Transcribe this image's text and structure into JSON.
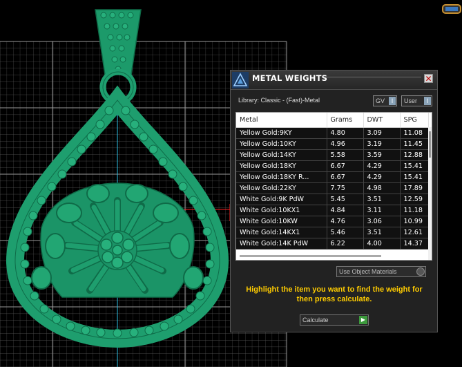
{
  "panel": {
    "title": "METAL WEIGHTS",
    "close_glyph": "✕",
    "library_label": "Library: Classic - (Fast)-Metal",
    "toggles": [
      {
        "label": "GV",
        "button_glyph": "I"
      },
      {
        "label": "User",
        "button_glyph": "I"
      }
    ],
    "table": {
      "columns": [
        "Metal",
        "Grams",
        "DWT",
        "SPG"
      ],
      "rows": [
        [
          "Yellow Gold:9KY",
          "4.80",
          "3.09",
          "11.08"
        ],
        [
          "Yellow Gold:10KY",
          "4.96",
          "3.19",
          "11.45"
        ],
        [
          "Yellow Gold:14KY",
          "5.58",
          "3.59",
          "12.88"
        ],
        [
          "Yellow Gold:18KY",
          "6.67",
          "4.29",
          "15.41"
        ],
        [
          "Yellow Gold:18KY R...",
          "6.67",
          "4.29",
          "15.41"
        ],
        [
          "Yellow Gold:22KY",
          "7.75",
          "4.98",
          "17.89"
        ],
        [
          "White Gold:9K PdW",
          "5.45",
          "3.51",
          "12.59"
        ],
        [
          "White Gold:10KX1",
          "4.84",
          "3.11",
          "11.18"
        ],
        [
          "White Gold:10KW",
          "4.76",
          "3.06",
          "10.99"
        ],
        [
          "White Gold:14KX1",
          "5.46",
          "3.51",
          "12.61"
        ],
        [
          "White Gold:14K PdW",
          "6.22",
          "4.00",
          "14.37"
        ]
      ]
    },
    "use_object_materials": "Use Object Materials",
    "instructions": "Highlight the item you want to find the weight for then press calculate.",
    "calculate_label": "Calculate",
    "calculate_arrow": "▶"
  },
  "colors": {
    "model_green": "#1e9e6e",
    "model_dark": "#0f6b48",
    "grid": "#8a8a8a",
    "instructions_text": "#ffcc00",
    "axis_red": "#ff2020",
    "axis_cyan": "#2ec4e8"
  },
  "icons": {
    "app_logo": "matrix-logo-icon",
    "close": "close-icon",
    "calculate": "play-arrow-icon",
    "viewport_widget": "view-cube-icon"
  }
}
